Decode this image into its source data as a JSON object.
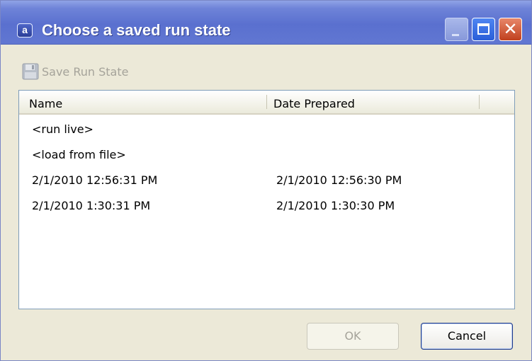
{
  "window": {
    "title": "Choose a saved run state",
    "app_icon_letter": "a"
  },
  "toolbar": {
    "save_run_state_label": "Save Run State",
    "save_icon": "floppy-disk-icon"
  },
  "list": {
    "columns": [
      "Name",
      "Date Prepared"
    ],
    "rows": [
      {
        "name": "<run live>",
        "date": ""
      },
      {
        "name": "<load from file>",
        "date": ""
      },
      {
        "name": "2/1/2010 12:56:31 PM",
        "date": "2/1/2010 12:56:30 PM"
      },
      {
        "name": "2/1/2010 1:30:31 PM",
        "date": "2/1/2010 1:30:30 PM"
      }
    ]
  },
  "buttons": {
    "ok_label": "OK",
    "cancel_label": "Cancel"
  },
  "colors": {
    "titlebar": "#5A70CF",
    "window_bg": "#ECE9D8",
    "disabled_text": "#A5A39A",
    "close_button": "#C0401E"
  }
}
